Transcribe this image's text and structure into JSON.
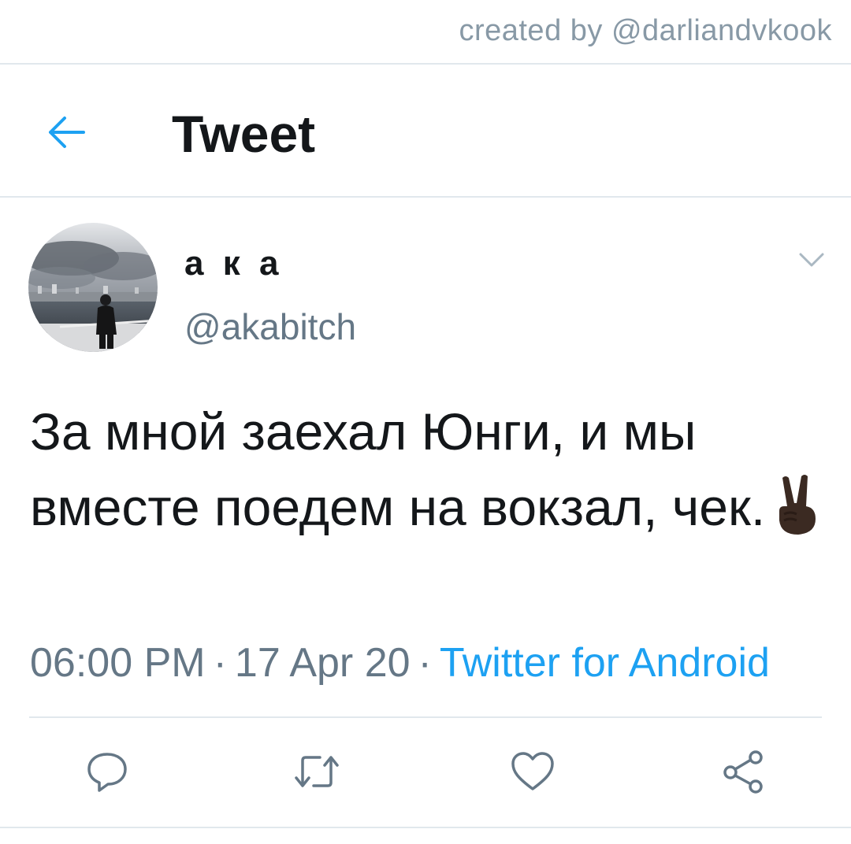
{
  "watermark": "created by @darliandvkook",
  "header": {
    "title": "Tweet",
    "back_icon": "arrow-left-icon"
  },
  "tweet": {
    "author_name": "а к а",
    "author_handle": "@akabitch",
    "text": "За мной заехал Юнги, и мы вместе поедем на вокзал, чек.",
    "emoji": "victory-hand-dark-skin-tone",
    "time": "06:00 PM",
    "date": "17 Apr 20",
    "separator": "·",
    "source": "Twitter for Android"
  },
  "actions": [
    {
      "name": "reply",
      "icon": "speech-bubble-icon"
    },
    {
      "name": "retweet",
      "icon": "retweet-icon"
    },
    {
      "name": "like",
      "icon": "heart-icon"
    },
    {
      "name": "share",
      "icon": "share-icon"
    }
  ],
  "colors": {
    "accent": "#1da1f2",
    "text": "#14171a",
    "secondary": "#657786",
    "divider": "#e1e8ed"
  }
}
